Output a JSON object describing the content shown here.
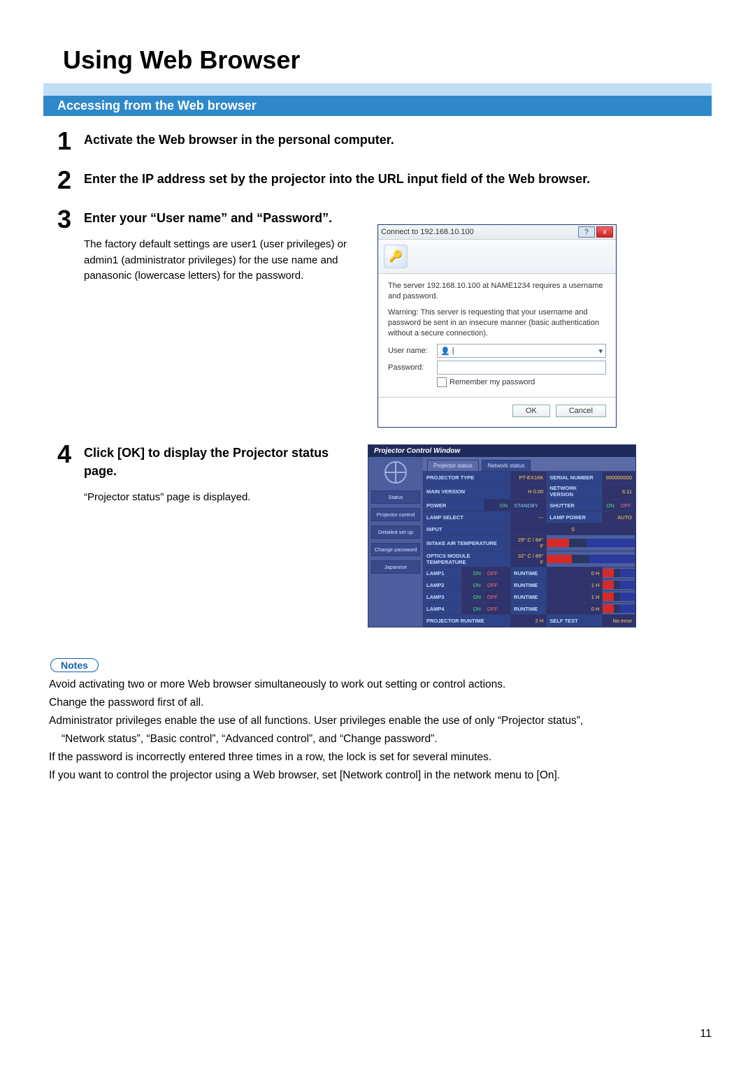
{
  "page": {
    "title": "Using Web Browser",
    "heading": "Accessing from the Web browser",
    "page_number": "11"
  },
  "steps": {
    "s1": {
      "num": "1",
      "title": "Activate the Web browser in the personal computer."
    },
    "s2": {
      "num": "2",
      "title": "Enter the IP address set by the projector into the URL input field of the Web browser."
    },
    "s3": {
      "num": "3",
      "title": "Enter your “User name” and “Password”.",
      "detail": "The factory default settings are user1 (user privileges) or admin1 (administrator privileges) for the use name and panasonic (lowercase letters) for the password."
    },
    "s4": {
      "num": "4",
      "title": "Click [OK] to display the Projector status page.",
      "detail": "“Projector status” page is displayed."
    }
  },
  "auth_dialog": {
    "title": "Connect to 192.168.10.100",
    "msg1": "The server 192.168.10.100 at NAME1234 requires a username and password.",
    "msg2": "Warning: This server is requesting that your username and password be sent in an insecure manner (basic authentication without a secure connection).",
    "user_label": "User name:",
    "pass_label": "Password:",
    "remember": "Remember my password",
    "ok": "OK",
    "cancel": "Cancel"
  },
  "pcw": {
    "window_title": "Projector Control Window",
    "side": {
      "status": "Status",
      "projector": "Projector control",
      "detailed": "Detailed set up",
      "change": "Change password",
      "jp": "Japanese"
    },
    "tabs": {
      "t1": "Projector status",
      "t2": "Network status"
    },
    "rows": {
      "projector_type": {
        "lbl": "PROJECTOR TYPE",
        "val": "PT-EX16K"
      },
      "serial": {
        "lbl": "SERIAL NUMBER",
        "val": "000000000"
      },
      "main_ver": {
        "lbl": "MAIN VERSION",
        "val": "H 0.00"
      },
      "net_ver": {
        "lbl": "NETWORK VERSION",
        "val": "6.11"
      },
      "power": {
        "lbl": "POWER",
        "on": "ON",
        "standby": "STANDBY"
      },
      "shutter": {
        "lbl": "SHUTTER",
        "on": "ON",
        "off": "OFF"
      },
      "lamp_select": {
        "lbl": "LAMP SELECT",
        "val": "---"
      },
      "lamp_power": {
        "lbl": "LAMP POWER",
        "val": "AUTO"
      },
      "input": {
        "lbl": "INPUT",
        "val": "S"
      },
      "intake": {
        "lbl": "INTAKE AIR TEMPERATURE",
        "val": "29°  C / 84°  F"
      },
      "optics": {
        "lbl": "OPTICS MODULE TEMPERATURE",
        "val": "32°  C / 89°  F"
      },
      "lamp1": {
        "lbl": "LAMP1",
        "on": "ON",
        "off": "OFF",
        "rt": "RUNTIME",
        "h": "0 H"
      },
      "lamp2": {
        "lbl": "LAMP2",
        "on": "ON",
        "off": "OFF",
        "rt": "RUNTIME",
        "h": "1 H"
      },
      "lamp3": {
        "lbl": "LAMP3",
        "on": "ON",
        "off": "OFF",
        "rt": "RUNTIME",
        "h": "1 H"
      },
      "lamp4": {
        "lbl": "LAMP4",
        "on": "ON",
        "off": "OFF",
        "rt": "RUNTIME",
        "h": "0 H"
      },
      "proj_rt": {
        "lbl": "PROJECTOR RUNTIME",
        "val": "2 H"
      },
      "selftest": {
        "lbl": "SELF TEST",
        "val": "No error"
      }
    }
  },
  "notes": {
    "label": "Notes",
    "n1": "Avoid activating two or more Web browser simultaneously to work out setting or control actions.",
    "n2": "Change the password first of all.",
    "n3a": "Administrator privileges enable the use of all functions. User privileges enable the use of only “Projector status”,",
    "n3b": "“Network status”, “Basic control”, “Advanced control”, and “Change password”.",
    "n4": "If the password is incorrectly entered three times in a row, the lock is set for several minutes.",
    "n5": "If you want to control the projector using a Web browser, set [Network control] in the network menu to [On]."
  }
}
